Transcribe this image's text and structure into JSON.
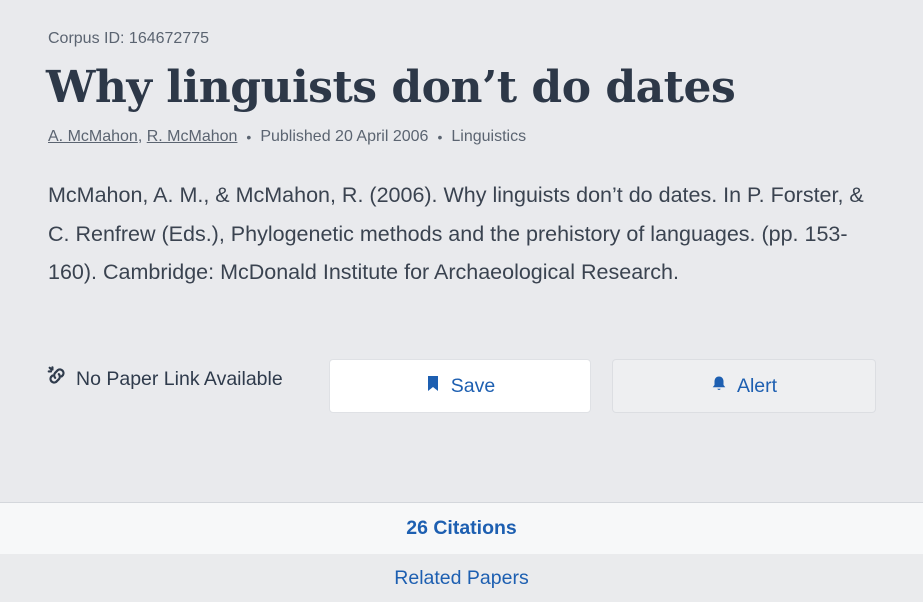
{
  "paper": {
    "corpus_id": "Corpus ID: 164672775",
    "title": "Why linguists don’t do dates",
    "authors": [
      "A. McMahon",
      "R. McMahon"
    ],
    "author_separator": ",",
    "published": "Published 20 April 2006",
    "field": "Linguistics",
    "bullet": "•",
    "abstract": "McMahon, A. M., & McMahon, R. (2006). Why linguists don’t do dates. In P. Forster, & C. Renfrew (Eds.), Phylogenetic methods and the prehistory of languages. (pp. 153-160). Cambridge: McDonald Institute for Archaeological Research."
  },
  "actions": {
    "no_link": {
      "label": "No Paper Link Available",
      "icon": "broken-link-icon"
    },
    "save": {
      "label": "Save",
      "icon": "bookmark-icon"
    },
    "alert": {
      "label": "Alert",
      "icon": "bell-icon"
    }
  },
  "tabs": {
    "citations": "26 Citations",
    "related": "Related Papers"
  },
  "colors": {
    "background": "#e9eaed",
    "accent": "#1d5fb1",
    "title": "#2d3848",
    "muted": "#5b6471"
  }
}
